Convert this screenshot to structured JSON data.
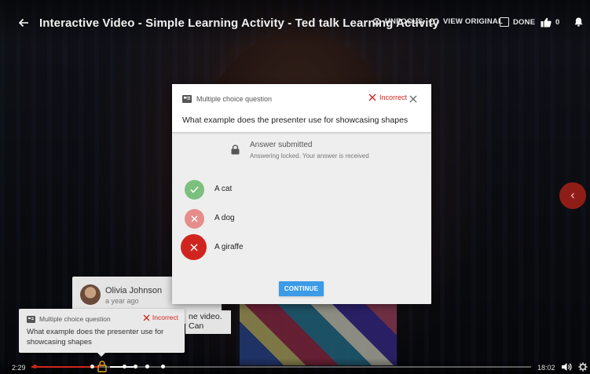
{
  "window": {
    "title": "Interactive Video - Simple Learning Activity - Ted talk Learning Activity"
  },
  "toolbar": {
    "unfocus_label": "UNFOCUS",
    "view_original_label": "VIEW ORIGINAL",
    "done_label": "DONE",
    "like_count": "0"
  },
  "modal": {
    "type_label": "Multiple choice question",
    "status_label": "Incorrect",
    "question": "What example does the presenter use for showcasing shapes",
    "submitted_title": "Answer submitted",
    "submitted_text": "Answering locked. Your answer is received",
    "options": [
      {
        "label": "A cat",
        "state": "correct",
        "color": "#7cc07e"
      },
      {
        "label": "A dog",
        "state": "wrong",
        "color": "#e58d8b"
      },
      {
        "label": "A giraffe",
        "state": "selected-wrong",
        "color": "#d0251e"
      }
    ],
    "continue_label": "CONTINUE"
  },
  "comment": {
    "author": "Olivia Johnson",
    "time": "a year ago",
    "text_fragment": "ne video. Can"
  },
  "mini_card": {
    "type_label": "Multiple choice question",
    "status_label": "Incorrect",
    "question": "What example does the presenter use for showcasing shapes"
  },
  "player": {
    "current_time": "2:29",
    "total_time": "18:02",
    "progress_fraction": 0.138
  },
  "colors": {
    "accent_red": "#d0251e",
    "primary_blue": "#3b9be8",
    "correct_green": "#7cc07e"
  }
}
